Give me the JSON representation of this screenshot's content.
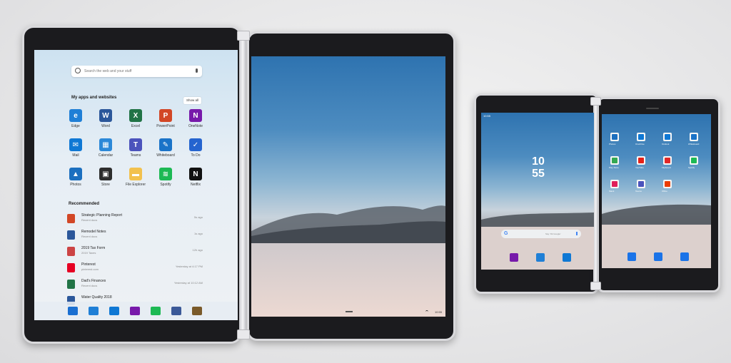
{
  "search": {
    "placeholder": "Search the web and your stuff"
  },
  "apps_section": {
    "title": "My apps and websites",
    "show_all": "Show all"
  },
  "apps": [
    {
      "label": "Edge",
      "color": "#1f7fd6",
      "glyph": "e"
    },
    {
      "label": "Word",
      "color": "#2b579a",
      "glyph": "W"
    },
    {
      "label": "Excel",
      "color": "#217346",
      "glyph": "X"
    },
    {
      "label": "PowerPoint",
      "color": "#d24726",
      "glyph": "P"
    },
    {
      "label": "OneNote",
      "color": "#7719aa",
      "glyph": "N"
    },
    {
      "label": "Mail",
      "color": "#0f78d4",
      "glyph": "✉"
    },
    {
      "label": "Calendar",
      "color": "#2b88d8",
      "glyph": "▦"
    },
    {
      "label": "Teams",
      "color": "#4b53bc",
      "glyph": "T"
    },
    {
      "label": "Whiteboard",
      "color": "#1a73c8",
      "glyph": "✎"
    },
    {
      "label": "To Do",
      "color": "#2564cf",
      "glyph": "✓"
    },
    {
      "label": "Photos",
      "color": "#1c6fbf",
      "glyph": "▲"
    },
    {
      "label": "Store",
      "color": "#2d2d2d",
      "glyph": "▣"
    },
    {
      "label": "File Explorer",
      "color": "#f2c14e",
      "glyph": "▬"
    },
    {
      "label": "Spotify",
      "color": "#1db954",
      "glyph": "≋"
    },
    {
      "label": "Netflix",
      "color": "#111111",
      "glyph": "N"
    }
  ],
  "recommended": {
    "title": "Recommended",
    "items": [
      {
        "title": "Strategic Planning Report",
        "sub": "Recent docs",
        "when": "5s ago",
        "color": "#d24726"
      },
      {
        "title": "Remodel Notes",
        "sub": "Recent docs",
        "when": "1s ago",
        "color": "#2b579a"
      },
      {
        "title": "2019 Tax Form",
        "sub": "2019 Taxes",
        "when": "12h ago",
        "color": "#c44"
      },
      {
        "title": "Pinterest",
        "sub": "pinterest.com",
        "when": "Yesterday at 4:17 PM",
        "color": "#e60023"
      },
      {
        "title": "Dad's Finances",
        "sub": "Recent docs",
        "when": "Yesterday at 10:12 AM",
        "color": "#217346"
      },
      {
        "title": "Water Quality 2018",
        "sub": "",
        "when": "",
        "color": "#2b579a"
      }
    ]
  },
  "taskbar": [
    {
      "name": "windows",
      "color": "#1a6fd1"
    },
    {
      "name": "edge",
      "color": "#1f7fd6"
    },
    {
      "name": "mail",
      "color": "#0f78d4"
    },
    {
      "name": "onenote",
      "color": "#7719aa"
    },
    {
      "name": "spotify",
      "color": "#1db954"
    },
    {
      "name": "facebook",
      "color": "#3b5998"
    },
    {
      "name": "files",
      "color": "#7a5a2a"
    }
  ],
  "tray": {
    "time": "10:55"
  },
  "phone": {
    "status_time": "10:55",
    "clock_hour": "10",
    "clock_minute": "55",
    "search_text": "Say 'Ok Google'",
    "dock_left": [
      {
        "name": "onenote",
        "color": "#7719aa"
      },
      {
        "name": "edge",
        "color": "#1f7fd6"
      },
      {
        "name": "outlook",
        "color": "#0f78d4"
      }
    ],
    "dock_right": [
      {
        "name": "phone",
        "color": "#1a73e8"
      },
      {
        "name": "messages",
        "color": "#1a73e8"
      },
      {
        "name": "camera",
        "color": "#1a73e8"
      }
    ],
    "grid": [
      {
        "label": "Photos",
        "color": "#1c6fbf"
      },
      {
        "label": "OneDrive",
        "color": "#0f78d4"
      },
      {
        "label": "Outlook",
        "color": "#0f78d4"
      },
      {
        "label": "Whiteboard",
        "color": "#1a73c8"
      },
      {
        "label": "Play Store",
        "color": "#34a853"
      },
      {
        "label": "YouTube",
        "color": "#e62117"
      },
      {
        "label": "Flipboard",
        "color": "#e12828"
      },
      {
        "label": "Spotify",
        "color": "#1db954"
      },
      {
        "label": "Slack",
        "color": "#e01e5a"
      },
      {
        "label": "Teams",
        "color": "#4b53bc"
      },
      {
        "label": "Office",
        "color": "#eb3c00"
      }
    ]
  }
}
